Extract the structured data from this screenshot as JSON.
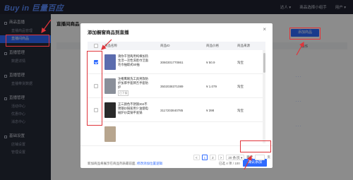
{
  "app": {
    "logo": "Buy in 巨量百应",
    "logo_sub": "Buyin"
  },
  "topbar": {
    "items": [
      "达人 ▾",
      "商品选择小组手",
      "用户 ▾"
    ]
  },
  "sidebar": {
    "groups": [
      {
        "label": "商品直播",
        "items": [
          "直播间商品",
          "直播商品管理"
        ]
      },
      {
        "label": "直播管理",
        "items": [
          "数据详情"
        ]
      },
      {
        "label": "直播管理",
        "items": [
          "直播带货数据"
        ]
      },
      {
        "label": "直播管理",
        "items": [
          "活动中心",
          "优惠中心",
          "消息中心"
        ]
      },
      {
        "label": "基础设置",
        "items": [
          "店铺设置",
          "管理设置"
        ]
      }
    ],
    "active_item": "直播间商品"
  },
  "main": {
    "title": "直播间商品",
    "add_button": "添加商品",
    "op_label": "操作"
  },
  "modal": {
    "title": "添加橱窗商品到直播",
    "close": "×",
    "columns": [
      "商品名称",
      "商品ID",
      "商品价格",
      "商品来源"
    ],
    "rows": [
      {
        "name": "请你干湿两用纯棉加热生活一次性洗脸巾洁面毛巾抽取式50抽",
        "id": "3060301770861",
        "price": "¥ 50.9",
        "source": "淘宝",
        "checked": true,
        "tag": "",
        "thumb": "#5b6cae"
      },
      {
        "name": "注榷鹰眼洗工具男款防护加厚手套牌舌手套防护",
        "id": "3502038371089",
        "price": "¥ 1.079",
        "source": "淘宝",
        "checked": false,
        "tag": "已下架",
        "thumb": "#8a8f99"
      },
      {
        "name": "正三颜色不锈钢304不锈钢炒锅家用少油烟电磁炉炒菜锅平底锅",
        "id": "3117203840785",
        "price": "¥ 398",
        "source": "淘宝",
        "checked": false,
        "tag": "",
        "thumb": "#2a2a2a"
      }
    ],
    "pagination": {
      "prev": "<",
      "pages": [
        "1",
        "2"
      ],
      "next": ">",
      "page_size": "20 条/页 ▾",
      "jump_label": "跳至",
      "jump_value": "",
      "page_suffix": "页"
    },
    "footer_tip": "新加商品将展示在商品列表最前面,",
    "footer_link": "修改添加位置逻辑",
    "selected_count": "已选 4 项 / 100",
    "confirm": "确认添加"
  },
  "colors": {
    "accent": "#2f6bff",
    "annotation": "#e0343a"
  }
}
